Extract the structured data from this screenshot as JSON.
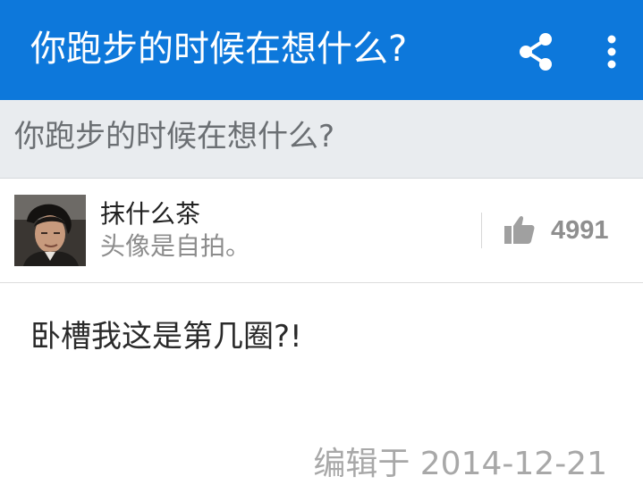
{
  "app_bar": {
    "title": "你跑步的时候在想什么?",
    "background": "#0d78db",
    "actions": [
      {
        "icon": "share-icon"
      },
      {
        "icon": "more-vert-icon"
      }
    ]
  },
  "question": {
    "title": "你跑步的时候在想什么?"
  },
  "answer": {
    "author": {
      "name": "抹什么茶",
      "bio": "头像是自拍。",
      "avatar_icon": "avatar-photo"
    },
    "votes": {
      "icon": "thumbs-up-icon",
      "count": "4991"
    },
    "content": "卧槽我这是第几圈?!",
    "edited": "编辑于 2014-12-21"
  }
}
